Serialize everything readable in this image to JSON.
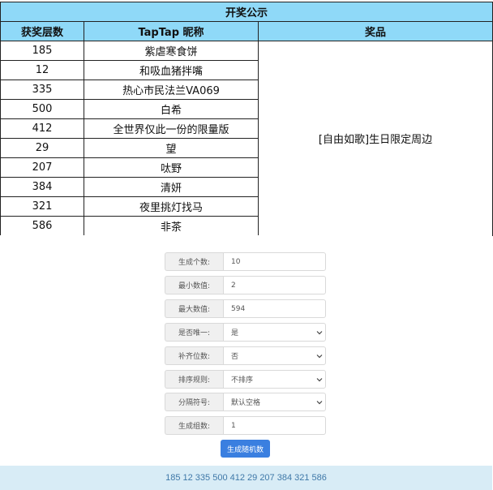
{
  "award_table": {
    "caption": "开奖公示",
    "headers": [
      "获奖层数",
      "TapTap 昵称",
      "奖品"
    ],
    "rows": [
      {
        "floor": "185",
        "nickname": "紫虐寒食饼"
      },
      {
        "floor": "12",
        "nickname": "和吸血猪拌嘴"
      },
      {
        "floor": "335",
        "nickname": "热心市民法兰VA069"
      },
      {
        "floor": "500",
        "nickname": "白希"
      },
      {
        "floor": "412",
        "nickname": "全世界仅此一份的限量版"
      },
      {
        "floor": "29",
        "nickname": "望"
      },
      {
        "floor": "207",
        "nickname": "呔野"
      },
      {
        "floor": "384",
        "nickname": "清妍"
      },
      {
        "floor": "321",
        "nickname": "夜里挑灯找马"
      },
      {
        "floor": "586",
        "nickname": "非茶"
      }
    ],
    "prize": "[自由如歌]生日限定周边"
  },
  "generator": {
    "fields": [
      {
        "label": "生成个数:",
        "value": "10",
        "type": "input"
      },
      {
        "label": "最小数值:",
        "value": "2",
        "type": "input"
      },
      {
        "label": "最大数值:",
        "value": "594",
        "type": "input"
      },
      {
        "label": "是否唯一:",
        "value": "是",
        "type": "select"
      },
      {
        "label": "补齐位数:",
        "value": "否",
        "type": "select"
      },
      {
        "label": "排序规则:",
        "value": "不排序",
        "type": "select"
      },
      {
        "label": "分隔符号:",
        "value": "默认空格",
        "type": "select"
      },
      {
        "label": "生成组数:",
        "value": "1",
        "type": "input"
      }
    ],
    "button_label": "生成随机数",
    "result": "185 12 335 500 412 29 207 384 321 586"
  },
  "icons": {
    "select_arrow": "chevron-down-icon"
  }
}
